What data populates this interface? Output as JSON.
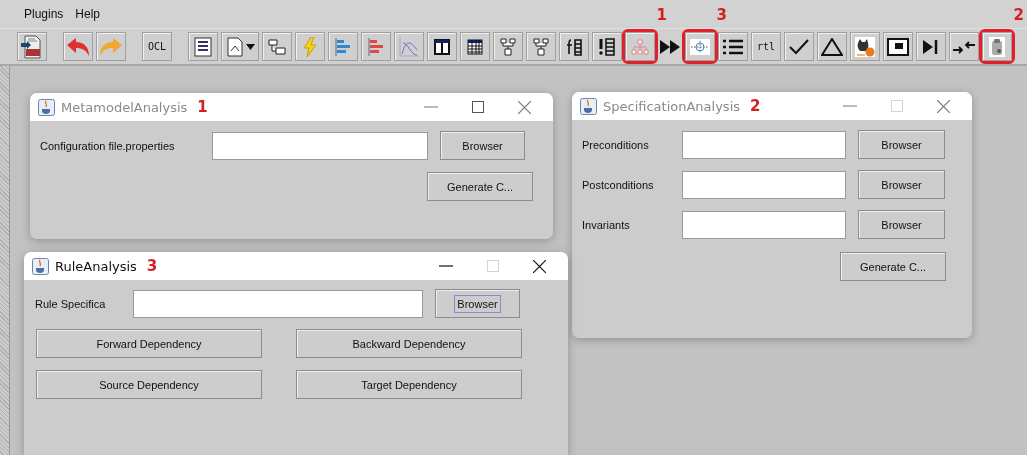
{
  "menu": [
    {
      "label": "Plugins"
    },
    {
      "label": "Help"
    }
  ],
  "toolbar": [
    [
      {
        "kind": "pdf",
        "highlighted": false
      }
    ],
    [
      {
        "kind": "undo",
        "highlighted": false
      },
      {
        "kind": "redo",
        "highlighted": false
      }
    ],
    [
      {
        "kind": "text",
        "label": "OCL",
        "highlighted": false
      }
    ],
    [
      {
        "kind": "document",
        "highlighted": false
      },
      {
        "kind": "dropdown",
        "highlighted": false
      },
      {
        "kind": "flow",
        "highlighted": false
      },
      {
        "kind": "bolt",
        "highlighted": false
      },
      {
        "kind": "bars",
        "color": "#2a8ad8",
        "highlighted": false
      },
      {
        "kind": "bars",
        "color": "#e04848",
        "highlighted": false
      },
      {
        "kind": "curve",
        "highlighted": false
      },
      {
        "kind": "columns",
        "highlighted": false
      },
      {
        "kind": "table",
        "highlighted": false
      },
      {
        "kind": "blocks",
        "highlighted": false
      },
      {
        "kind": "blocks",
        "highlighted": false
      },
      {
        "kind": "formula",
        "highlighted": false
      },
      {
        "kind": "warnlist",
        "highlighted": false
      },
      {
        "kind": "orgchart",
        "highlighted": true,
        "callout": "1"
      },
      {
        "kind": "fastforward",
        "highlighted": false
      },
      {
        "kind": "node",
        "highlighted": true,
        "callout": "3"
      },
      {
        "kind": "list",
        "highlighted": false
      },
      {
        "kind": "text",
        "label": "rtl",
        "highlighted": false
      },
      {
        "kind": "check",
        "highlighted": false
      },
      {
        "kind": "triangle",
        "highlighted": false
      },
      {
        "kind": "cat",
        "highlighted": false
      },
      {
        "kind": "window",
        "highlighted": false
      },
      {
        "kind": "skip",
        "highlighted": false
      },
      {
        "kind": "arrows",
        "highlighted": false
      },
      {
        "kind": "clipboard",
        "highlighted": true,
        "callout": "2"
      }
    ]
  ],
  "windows": [
    {
      "title": "MetamodelAnalysis",
      "callout": "1",
      "active": false,
      "maximize_enabled": true,
      "rows": [
        {
          "label": "Configuration file.properties",
          "button": "Browser",
          "focused": false
        }
      ],
      "actions": [
        "Generate C..."
      ]
    },
    {
      "title": "SpecificationAnalysis",
      "callout": "2",
      "active": false,
      "maximize_enabled": false,
      "rows": [
        {
          "label": "Preconditions",
          "button": "Browser",
          "focused": false
        },
        {
          "label": "Postconditions",
          "button": "Browser",
          "focused": false
        },
        {
          "label": "Invariants",
          "button": "Browser",
          "focused": false
        }
      ],
      "actions": [
        "Generate C..."
      ]
    },
    {
      "title": "RuleAnalysis",
      "callout": "3",
      "active": true,
      "maximize_enabled": false,
      "rows": [
        {
          "label": "Rule Specifica",
          "button": "Browser",
          "focused": true
        }
      ],
      "actions": [
        "Forward Dependency",
        "Backward Dependency",
        "Source Dependency",
        "Target Dependency"
      ]
    }
  ]
}
